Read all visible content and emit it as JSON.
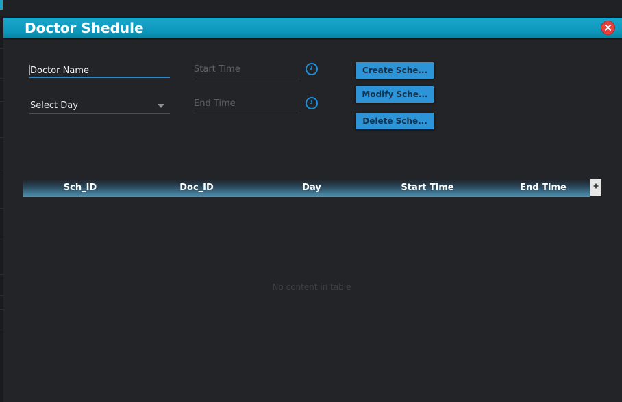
{
  "window": {
    "title": "Doctor Shedule"
  },
  "form": {
    "doctor_name": {
      "value": "Doctor Name"
    },
    "select_day": {
      "value": "Select Day"
    },
    "start_time": {
      "placeholder": "Start Time"
    },
    "end_time": {
      "placeholder": "End Time"
    }
  },
  "buttons": {
    "create": "Create Sche...",
    "modify": "Modify Sche...",
    "delete": "Delete Sche..."
  },
  "table": {
    "columns": [
      "Sch_ID",
      "Doc_ID",
      "Day",
      "Start Time",
      "End Time"
    ],
    "rows": [],
    "empty_text": "No content in table"
  },
  "colors": {
    "titlebar": "#0c96ba",
    "accent": "#2d94d8",
    "close": "#e8403f"
  },
  "icons": {
    "close": "close-icon",
    "clock": "clock-icon",
    "dropdown": "chevron-down-icon",
    "column_menu": "plus-icon"
  }
}
